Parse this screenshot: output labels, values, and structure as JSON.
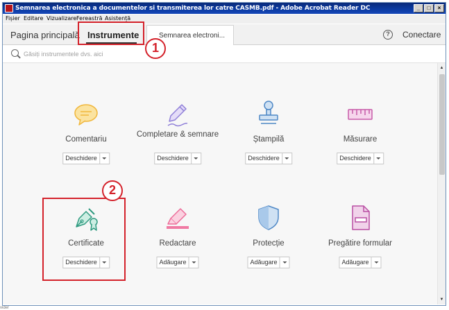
{
  "window": {
    "title": "Semnarea electronica a documentelor si transmiterea lor catre CASMB.pdf - Adobe Acrobat Reader DC",
    "controls": {
      "minimize": "_",
      "maximize": "□",
      "close": "×"
    }
  },
  "menu": [
    "Fișier",
    "Editare",
    "Vizualizare",
    "Fereastră",
    "Asistență"
  ],
  "tabs": {
    "home": "Pagina principală",
    "tools": "Instrumente",
    "document": "Semnarea electroni..."
  },
  "header_right": {
    "help_symbol": "?",
    "connect": "Conectare"
  },
  "search": {
    "placeholder": "Găsiți instrumentele dvs. aici"
  },
  "tools": [
    {
      "name": "Comentariu",
      "action": "Deschidere",
      "icon": "comment-icon",
      "color": "#f5c64a"
    },
    {
      "name": "Completare & semnare",
      "action": "Deschidere",
      "icon": "fill-sign-icon",
      "color": "#9f8fe0"
    },
    {
      "name": "Ștampilă",
      "action": "Deschidere",
      "icon": "stamp-icon",
      "color": "#4f88c6"
    },
    {
      "name": "Măsurare",
      "action": "Deschidere",
      "icon": "ruler-icon",
      "color": "#d35bb0"
    },
    {
      "name": "Certificate",
      "action": "Deschidere",
      "icon": "certificate-pen-icon",
      "color": "#3aa38a"
    },
    {
      "name": "Redactare",
      "action": "Adăugare",
      "icon": "redact-marker-icon",
      "color": "#f07aa3"
    },
    {
      "name": "Protecție",
      "action": "Adăugare",
      "icon": "shield-icon",
      "color": "#4f88c6"
    },
    {
      "name": "Pregătire formular",
      "action": "Adăugare",
      "icon": "form-icon",
      "color": "#c45bb0"
    }
  ],
  "annotations": {
    "badge1": "1",
    "badge2": "2"
  },
  "status_fragment": "vider"
}
